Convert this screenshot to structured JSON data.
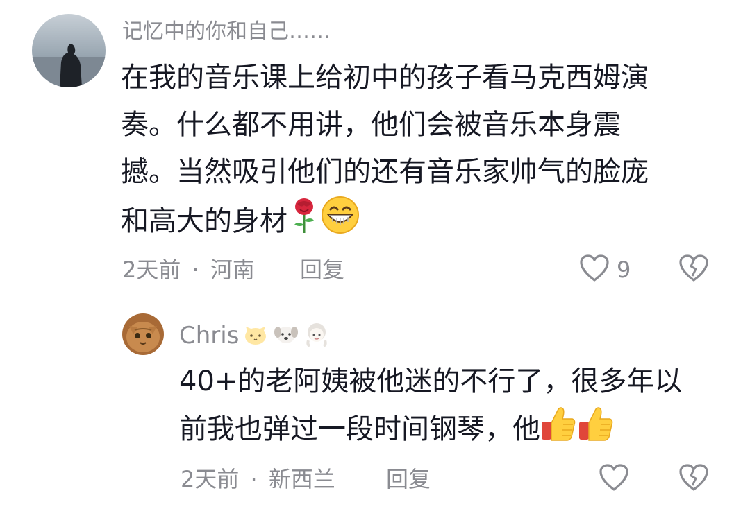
{
  "comments": [
    {
      "username": "记忆中的你和自己……",
      "text": "在我的音乐课上给初中的孩子看马克西姆演奏。什么都不用讲，他们会被音乐本身震撼。当然吸引他们的还有音乐家帅气的脸庞和高大的身材",
      "text_lines": [
        "在我的音乐课上给初中的孩子看马克西姆演",
        "奏。什么都不用讲，他们会被音乐本身震",
        "撼。当然吸引他们的还有音乐家帅气的脸庞",
        "和高大的身材"
      ],
      "emojis": [
        "rose-emoji",
        "grin-emoji"
      ],
      "time": "2天前",
      "separator": "·",
      "location": "河南",
      "reply_label": "回复",
      "like_count": "9",
      "icons": [
        "heart-outline-icon",
        "broken-heart-icon"
      ]
    },
    {
      "username": "Chris",
      "username_emojis": [
        "cat-face-emoji",
        "dog-face-emoji",
        "girl-emoji"
      ],
      "text": "40+的老阿姨被他迷的不行了，很多年以前我也弹过一段时间钢琴，他",
      "text_lines": [
        "40+的老阿姨被他迷的不行了，很多年以",
        "前我也弹过一段时间钢琴，他"
      ],
      "emojis": [
        "thumbs-up-emoji",
        "thumbs-up-emoji"
      ],
      "time": "2天前",
      "separator": "·",
      "location": "新西兰",
      "reply_label": "回复",
      "like_count": "",
      "icons": [
        "heart-outline-icon",
        "broken-heart-icon"
      ]
    }
  ],
  "colors": {
    "text_primary": "#161823",
    "text_secondary": "#8a8b91",
    "background": "#ffffff"
  }
}
